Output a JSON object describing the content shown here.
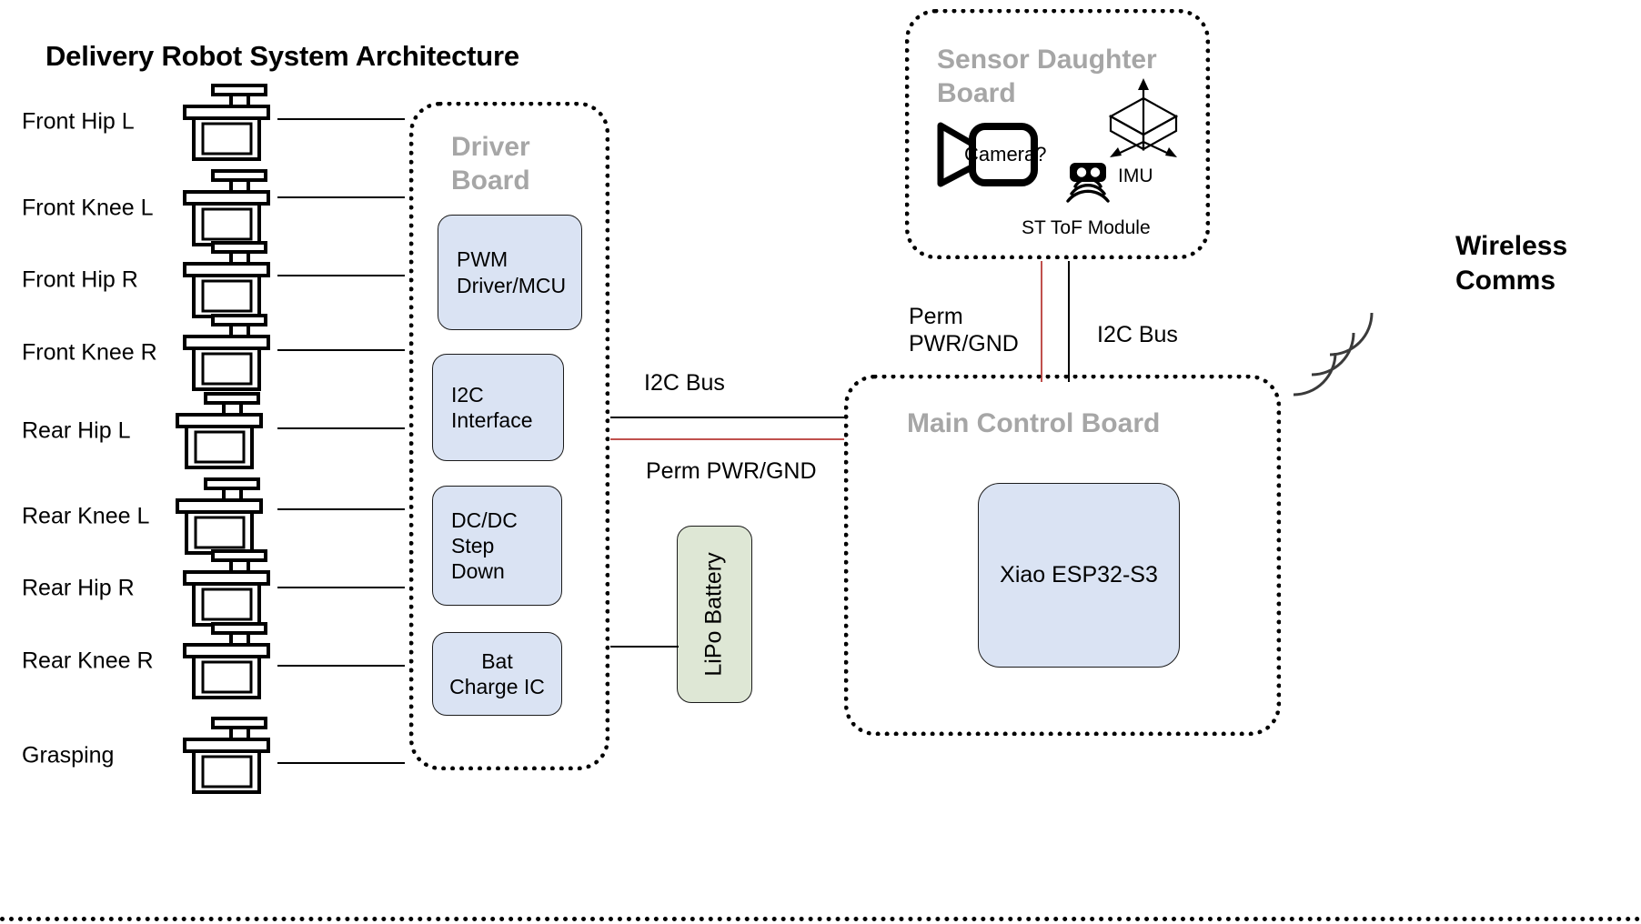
{
  "title": "Delivery Robot System Architecture",
  "servos": [
    {
      "label": "Front Hip L",
      "icon": "servo-icon"
    },
    {
      "label": "Front Knee L",
      "icon": "servo-icon"
    },
    {
      "label": "Front Hip R",
      "icon": "servo-icon"
    },
    {
      "label": "Front Knee R",
      "icon": "servo-icon"
    },
    {
      "label": "Rear Hip L",
      "icon": "servo-icon"
    },
    {
      "label": "Rear Knee L",
      "icon": "servo-icon"
    },
    {
      "label": "Rear Hip R",
      "icon": "servo-icon"
    },
    {
      "label": "Rear Knee R",
      "icon": "servo-icon"
    },
    {
      "label": "Grasping",
      "icon": "servo-icon"
    }
  ],
  "driver_board": {
    "title": "Driver\nBoard",
    "title_line1": "Driver",
    "title_line2": "Board",
    "chips": [
      {
        "line1": "PWM",
        "line2": "Driver/MCU",
        "line3": "",
        "line4": ""
      },
      {
        "line1": "I2C",
        "line2": "Interface",
        "line3": "",
        "line4": ""
      },
      {
        "line1": "DC/DC",
        "line2": "Step",
        "line3": "Down",
        "line4": ""
      },
      {
        "line1": "Bat",
        "line2": "Charge IC",
        "line3": "",
        "line4": ""
      }
    ]
  },
  "sensor_board": {
    "title_line1": "Sensor Daughter",
    "title_line2": "Board",
    "camera_label": "Camera?",
    "imu_label": "IMU",
    "tof_label": "ST ToF Module"
  },
  "main_board": {
    "title": "Main Control Board",
    "chip_label": "Xiao ESP32-S3"
  },
  "battery": {
    "label": "LiPo Battery"
  },
  "wireless": {
    "line1": "Wireless",
    "line2": "Comms"
  },
  "buses": {
    "driver_i2c": "I2C Bus",
    "driver_pwr": "Perm PWR/GND",
    "sensor_pwr_line1": "Perm",
    "sensor_pwr_line2": "PWR/GND",
    "sensor_i2c": "I2C Bus"
  },
  "colors": {
    "chip_fill": "#dae3f3",
    "chip_stroke": "#1b1b1b",
    "battery_fill": "#dee7d5",
    "board_title": "#a6a6a6",
    "power_red": "#c0504d",
    "signal_black": "#000000"
  }
}
